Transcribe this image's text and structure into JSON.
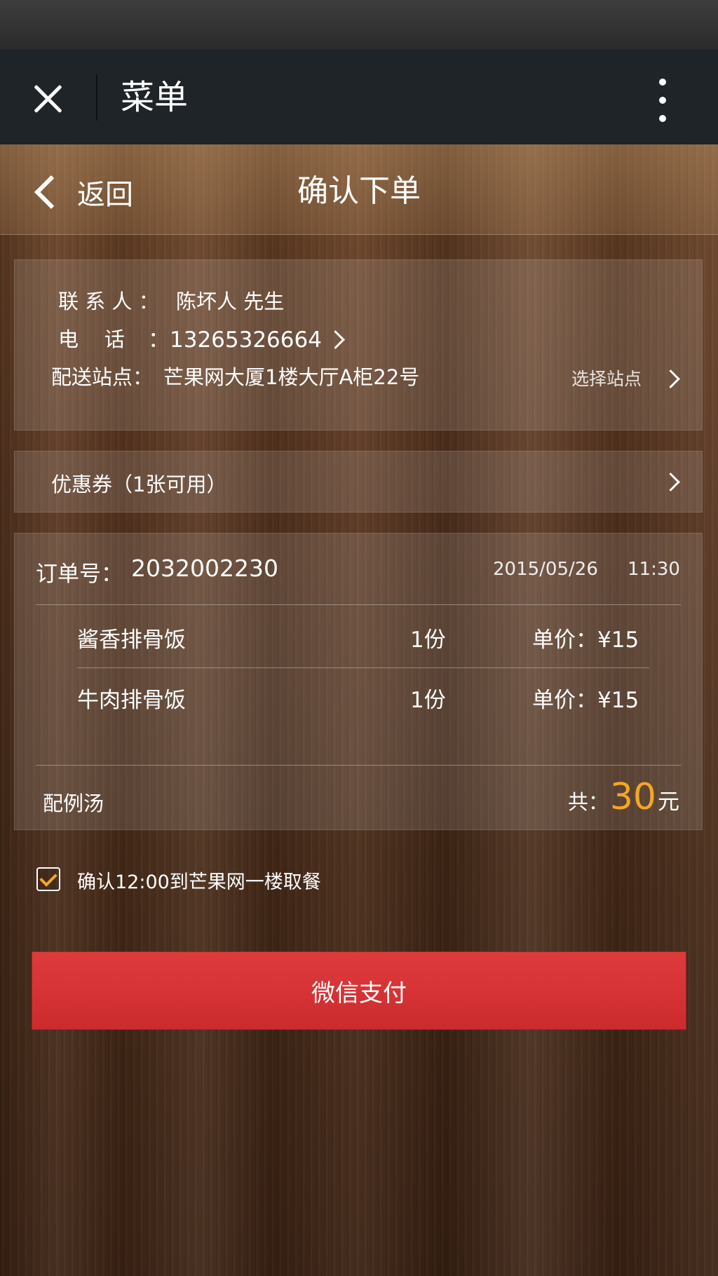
{
  "wechat_bar": {
    "title": "菜单"
  },
  "header": {
    "back_label": "返回",
    "title": "确认下单"
  },
  "contact": {
    "name_label": "联 系 人 ：",
    "name_value": "陈坏人 先生",
    "phone_label": "电    话",
    "phone_value": "：13265326664",
    "station_label": "配送站点：",
    "station_value": "芒果网大厦1楼大厅A柜22号",
    "select_station_label": "选择站点"
  },
  "coupon": {
    "label": "优惠券（1张可用）"
  },
  "order": {
    "number_label": "订单号：",
    "number_value": "2032002230",
    "date": "2015/05/26",
    "time": "11:30",
    "items": [
      {
        "name": "酱香排骨饭",
        "qty": "1份",
        "price": "单价：¥15"
      },
      {
        "name": "牛肉排骨饭",
        "qty": "1份",
        "price": "单价：¥15"
      }
    ],
    "side_note": "配例汤",
    "total_label": "共：",
    "total_value": "30",
    "total_unit": "元"
  },
  "confirm": {
    "text": "确认12:00到芒果网一楼取餐",
    "checked": true
  },
  "pay_button": {
    "label": "微信支付"
  },
  "colors": {
    "accent": "#f5a623",
    "pay_button": "#d33336",
    "wechat_bar": "#1f2428"
  }
}
